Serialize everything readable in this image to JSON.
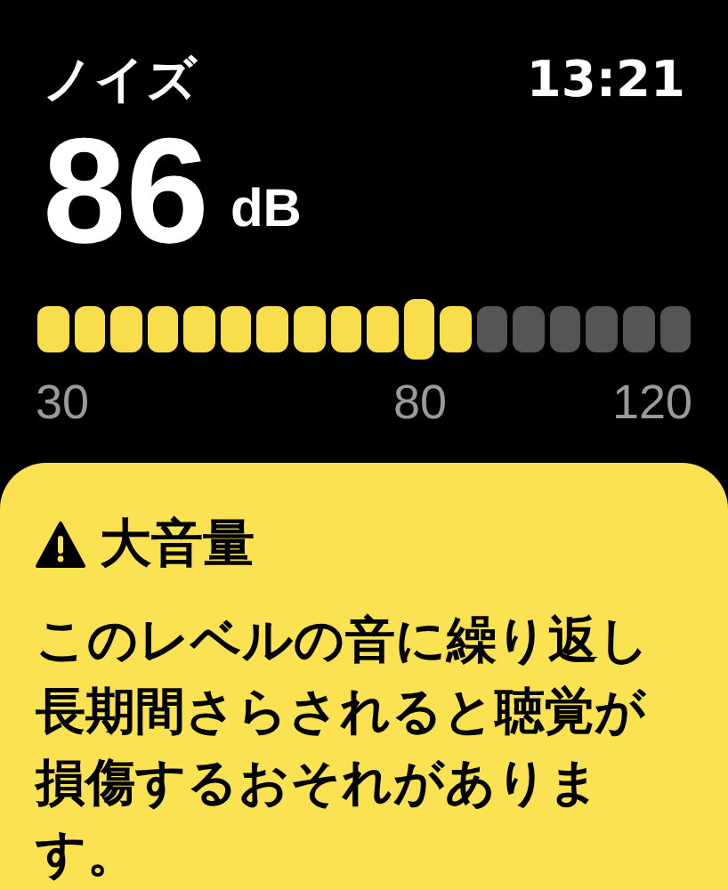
{
  "header": {
    "title": "ノイズ",
    "time": "13:21"
  },
  "reading": {
    "value": "86",
    "unit": "dB"
  },
  "meter": {
    "level": 0.667,
    "ticks": [
      "30",
      "80",
      "120"
    ]
  },
  "alert": {
    "title": "大音量",
    "message": "このレベルの音に繰り返し長期間さらされると聴覚が損傷するおそれがあります。"
  }
}
